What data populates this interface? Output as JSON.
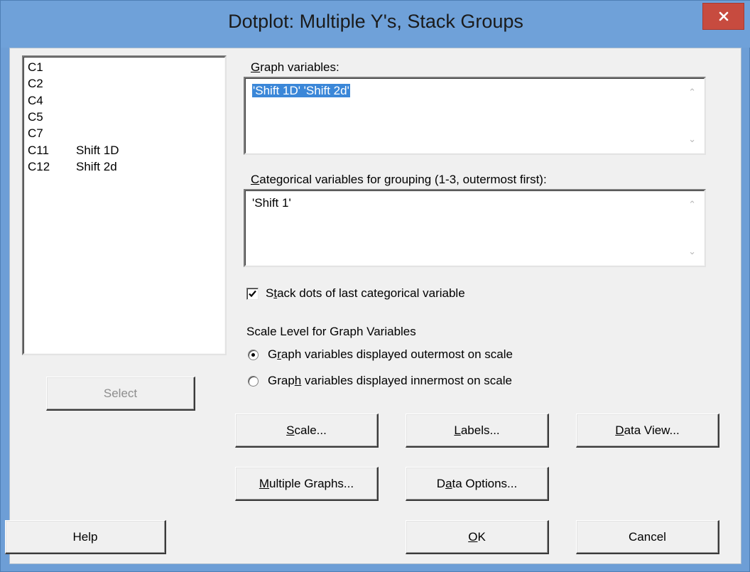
{
  "window": {
    "title": "Dotplot: Multiple Y's, Stack Groups",
    "close_icon": "close-icon"
  },
  "variable_list": {
    "items": [
      {
        "id": "C1",
        "name": ""
      },
      {
        "id": "C2",
        "name": ""
      },
      {
        "id": "C4",
        "name": ""
      },
      {
        "id": "C5",
        "name": ""
      },
      {
        "id": "C7",
        "name": ""
      },
      {
        "id": "C11",
        "name": "Shift 1D"
      },
      {
        "id": "C12",
        "name": "Shift 2d"
      }
    ]
  },
  "graph_variables": {
    "label": "Graph variables:",
    "value": "'Shift 1D' 'Shift 2d'"
  },
  "categorical_variables": {
    "label": "Categorical variables for grouping (1-3, outermost first):",
    "value": "'Shift 1'"
  },
  "stack_dots": {
    "label": "Stack dots of last categorical variable",
    "checked": true
  },
  "scale_level": {
    "heading": "Scale Level for Graph Variables",
    "options": [
      {
        "label": "Graph variables displayed outermost on scale",
        "selected": true
      },
      {
        "label": "Graph variables displayed innermost on scale",
        "selected": false
      }
    ]
  },
  "buttons": {
    "select": "Select",
    "scale": "Scale...",
    "labels": "Labels...",
    "data_view": "Data View...",
    "multiple_graphs": "Multiple Graphs...",
    "data_options": "Data Options...",
    "help": "Help",
    "ok": "OK",
    "cancel": "Cancel"
  },
  "colors": {
    "title_bar": "#6fa1d9",
    "close_button": "#c74b3f",
    "selection": "#3b87d8"
  }
}
